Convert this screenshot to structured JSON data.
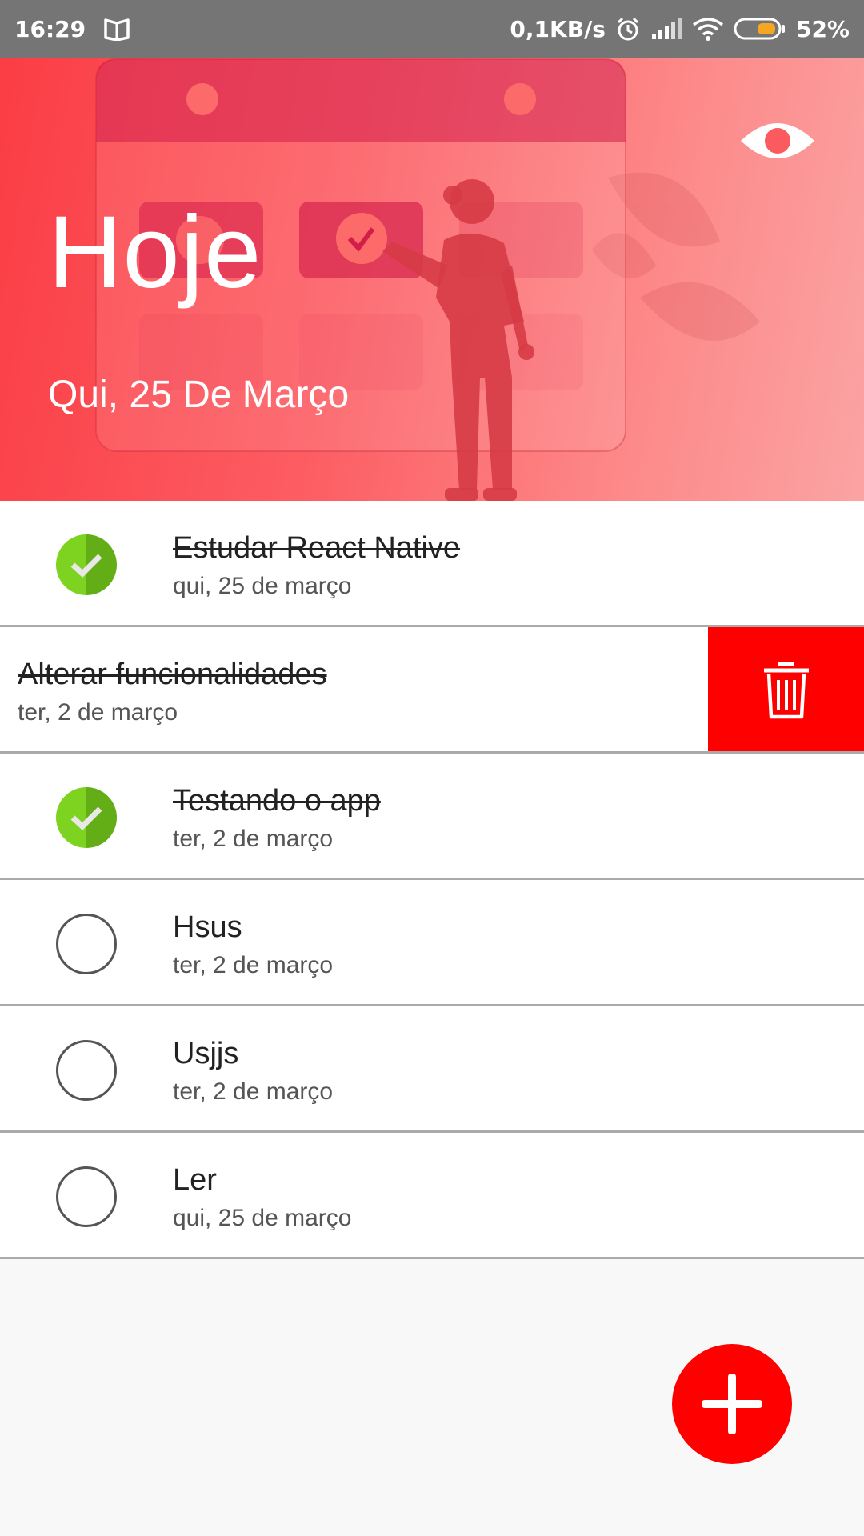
{
  "status_bar": {
    "time": "16:29",
    "network_speed": "0,1KB/s",
    "battery": "52%",
    "icons": [
      "book-icon",
      "alarm-icon",
      "signal-icon",
      "wifi-icon",
      "battery-icon"
    ]
  },
  "header": {
    "title": "Hoje",
    "date": "Qui, 25 De Março",
    "toggle_icon": "eye-icon"
  },
  "tasks": [
    {
      "title": "Estudar React Native",
      "date": "qui, 25 de março",
      "done": true
    },
    {
      "title": "Alterar funcionalidades",
      "date": "ter, 2 de março",
      "done": true,
      "swiped": true
    },
    {
      "title": "Testando o app",
      "date": "ter, 2 de março",
      "done": true
    },
    {
      "title": "Hsus",
      "date": "ter, 2 de março",
      "done": false
    },
    {
      "title": "Usjjs",
      "date": "ter, 2 de março",
      "done": false
    },
    {
      "title": "Ler",
      "date": "qui, 25 de março",
      "done": false
    }
  ],
  "fab": {
    "icon": "plus-icon"
  },
  "colors": {
    "accent": "#ff0000",
    "done_green": "#7ed321",
    "header_start": "#fb3d45",
    "header_end": "#fba3a3",
    "status_bar": "#757575"
  }
}
